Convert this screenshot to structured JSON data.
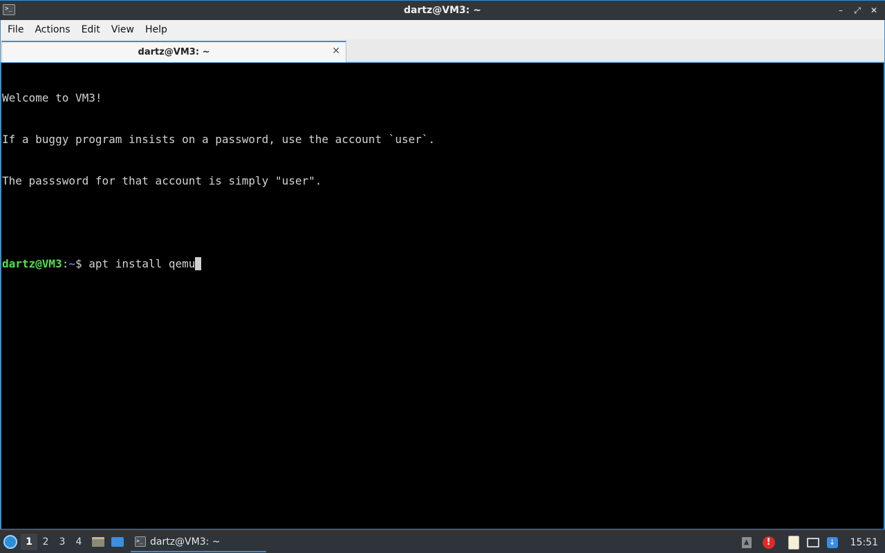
{
  "window": {
    "title": "dartz@VM3: ~",
    "app_icon": "terminal-icon",
    "controls": {
      "minimize": "–",
      "maximize": "⤢",
      "close": "✕"
    }
  },
  "menubar": {
    "items": [
      "File",
      "Actions",
      "Edit",
      "View",
      "Help"
    ]
  },
  "tabs": [
    {
      "label": "dartz@VM3: ~",
      "close": "✕"
    }
  ],
  "terminal": {
    "lines": [
      "Welcome to VM3!",
      "If a buggy program insists on a password, use the account `user`.",
      "The passsword for that account is simply \"user\"."
    ],
    "prompt": {
      "user_host": "dartz@VM3",
      "sep": ":",
      "path": "~",
      "dollar": "$ ",
      "command": "apt install qemu"
    }
  },
  "taskbar": {
    "desktops": [
      "1",
      "2",
      "3",
      "4"
    ],
    "active_desktop": "1",
    "window_button_label": "dartz@VM3: ~",
    "clock": "15:51",
    "tray_up_glyph": "▲",
    "tray_alert_glyph": "!",
    "tray_update_glyph": "↓"
  },
  "colors": {
    "accent": "#3d8fd1",
    "prompt_user": "#4fe04a",
    "prompt_path": "#5b7fd8",
    "terminal_bg": "#000000",
    "terminal_fg": "#d3d3d3"
  }
}
